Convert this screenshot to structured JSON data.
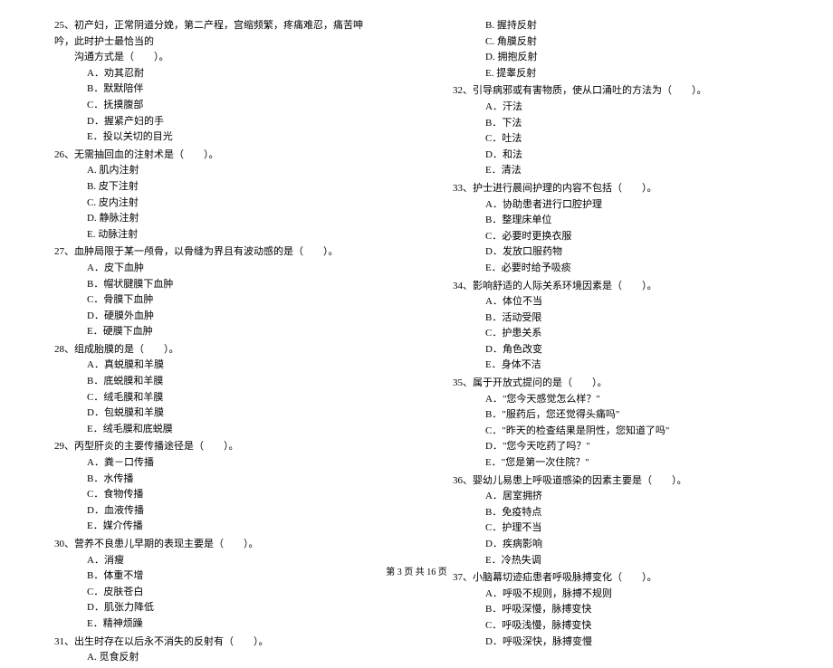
{
  "left": {
    "q25": {
      "text": "25、初产妇，正常阴道分娩，第二产程，宫缩频繁，疼痛难忍，痛苦呻吟，此时护士最恰当的",
      "text2": "沟通方式是（　　）。",
      "a": "A．劝其忍耐",
      "b": "B．默默陪伴",
      "c": "C．抚摸腹部",
      "d": "D．握紧产妇的手",
      "e": "E．投以关切的目光"
    },
    "q26": {
      "text": "26、无需抽回血的注射术是（　　）。",
      "a": "A. 肌内注射",
      "b": "B. 皮下注射",
      "c": "C. 皮内注射",
      "d": "D. 静脉注射",
      "e": "E. 动脉注射"
    },
    "q27": {
      "text": "27、血肿局限于某一颅骨，以骨缝为界且有波动感的是（　　）。",
      "a": "A．皮下血肿",
      "b": "B．帽状腱膜下血肿",
      "c": "C．骨膜下血肿",
      "d": "D．硬膜外血肿",
      "e": "E．硬膜下血肿"
    },
    "q28": {
      "text": "28、组成胎膜的是（　　）。",
      "a": "A．真蜕膜和羊膜",
      "b": "B．底蜕膜和羊膜",
      "c": "C．绒毛膜和羊膜",
      "d": "D．包蜕膜和羊膜",
      "e": "E．绒毛膜和底蜕膜"
    },
    "q29": {
      "text": "29、丙型肝炎的主要传播途径是（　　）。",
      "a": "A．粪－口传播",
      "b": "B．水传播",
      "c": "C．食物传播",
      "d": "D．血液传播",
      "e": "E．媒介传播"
    },
    "q30": {
      "text": "30、营养不良患儿早期的表现主要是（　　）。",
      "a": "A．消瘦",
      "b": "B．体重不增",
      "c": "C．皮肤苍白",
      "d": "D．肌张力降低",
      "e": "E．精神烦躁"
    },
    "q31": {
      "text": "31、出生时存在以后永不消失的反射有（　　）。",
      "a": "A. 觅食反射"
    }
  },
  "right": {
    "q31_cont": {
      "b": "B. 握持反射",
      "c": "C. 角膜反射",
      "d": "D. 拥抱反射",
      "e": "E. 提睾反射"
    },
    "q32": {
      "text": "32、引导病邪或有害物质，使从口涌吐的方法为（　　）。",
      "a": "A．汗法",
      "b": "B．下法",
      "c": "C．吐法",
      "d": "D．和法",
      "e": "E．清法"
    },
    "q33": {
      "text": "33、护士进行晨间护理的内容不包括（　　）。",
      "a": "A．协助患者进行口腔护理",
      "b": "B．整理床单位",
      "c": "C．必要时更换衣服",
      "d": "D．发放口服药物",
      "e": "E．必要时给予吸痰"
    },
    "q34": {
      "text": "34、影响舒适的人际关系环境因素是（　　）。",
      "a": "A．体位不当",
      "b": "B．活动受限",
      "c": "C．护患关系",
      "d": "D．角色改变",
      "e": "E．身体不洁"
    },
    "q35": {
      "text": "35、属于开放式提问的是（　　）。",
      "a": "A．\"您今天感觉怎么样？\"",
      "b": "B．\"服药后，您还觉得头痛吗\"",
      "c": "C．\"昨天的检查结果是阴性，您知道了吗\"",
      "d": "D．\"您今天吃药了吗？\"",
      "e": "E．\"您是第一次住院？\""
    },
    "q36": {
      "text": "36、婴幼儿易患上呼吸道感染的因素主要是（　　）。",
      "a": "A．居室拥挤",
      "b": "B．免疫特点",
      "c": "C．护理不当",
      "d": "D．疾病影响",
      "e": "E．冷热失调"
    },
    "q37": {
      "text": "37、小脑幕切迹疝患者呼吸脉搏变化（　　）。",
      "a": "A．呼吸不规则，脉搏不规则",
      "b": "B．呼吸深慢，脉搏变快",
      "c": "C．呼吸浅慢，脉搏变快",
      "d": "D．呼吸深快，脉搏变慢"
    }
  },
  "footer": "第 3 页 共 16 页"
}
